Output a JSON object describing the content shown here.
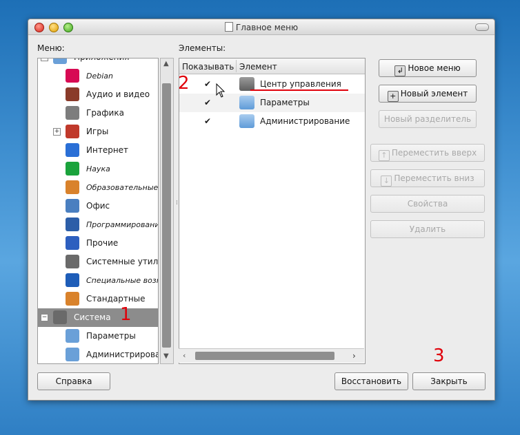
{
  "window": {
    "title": "Главное меню"
  },
  "menu_label": "Меню:",
  "elements_label": "Элементы:",
  "tree": [
    {
      "label": "Приложения",
      "italic": false,
      "icon": "folder-icon",
      "color": "#6aa0d8",
      "expander": "−"
    },
    {
      "label": "Debian",
      "italic": true,
      "icon": "debian-swirl-icon",
      "color": "#d70a53",
      "expander": ""
    },
    {
      "label": "Аудио и видео",
      "italic": false,
      "icon": "multimedia-icon",
      "color": "#8a3b2a",
      "expander": ""
    },
    {
      "label": "Графика",
      "italic": false,
      "icon": "camera-icon",
      "color": "#7d7d7d",
      "expander": ""
    },
    {
      "label": "Игры",
      "italic": false,
      "icon": "cards-icon",
      "color": "#c0392b",
      "expander": "+"
    },
    {
      "label": "Интернет",
      "italic": false,
      "icon": "globe-icon",
      "color": "#2a6fd6",
      "expander": ""
    },
    {
      "label": "Наука",
      "italic": true,
      "icon": "science-cube-icon",
      "color": "#1aa33c",
      "expander": ""
    },
    {
      "label": "Образовательные",
      "italic": true,
      "icon": "compass-icon",
      "color": "#d9822b",
      "expander": ""
    },
    {
      "label": "Офис",
      "italic": false,
      "icon": "office-icon",
      "color": "#4a7fc0",
      "expander": ""
    },
    {
      "label": "Программирование",
      "italic": true,
      "icon": "hammer-icon",
      "color": "#2c5ea8",
      "expander": ""
    },
    {
      "label": "Прочие",
      "italic": false,
      "icon": "other-apps-icon",
      "color": "#2d5fbf",
      "expander": ""
    },
    {
      "label": "Системные утилиты",
      "italic": false,
      "icon": "system-tools-icon",
      "color": "#6a6a6a",
      "expander": ""
    },
    {
      "label": "Специальные возможности",
      "italic": true,
      "icon": "accessibility-icon",
      "color": "#1e5db8",
      "expander": ""
    },
    {
      "label": "Стандартные",
      "italic": false,
      "icon": "accessories-icon",
      "color": "#d9822b",
      "expander": ""
    },
    {
      "label": "Система",
      "italic": false,
      "icon": "system-gear-icon",
      "color": "#6a6a6a",
      "expander": "−"
    },
    {
      "label": "Параметры",
      "italic": false,
      "icon": "folder-icon",
      "color": "#6aa0d8",
      "expander": ""
    },
    {
      "label": "Администрирование",
      "italic": false,
      "icon": "admin-folder-icon",
      "color": "#6aa0d8",
      "expander": ""
    }
  ],
  "table": {
    "col_show": "Показывать",
    "col_item": "Элемент",
    "rows": [
      {
        "checked": "✔",
        "label": "Центр управления",
        "icon": "control-center-icon"
      },
      {
        "checked": "✔",
        "label": "Параметры",
        "icon": "folder-icon"
      },
      {
        "checked": "✔",
        "label": "Администрирование",
        "icon": "admin-folder-icon"
      }
    ]
  },
  "buttons": {
    "new_menu": "Новое меню",
    "new_item": "Новый элемент",
    "new_separator": "Новый разделитель",
    "move_up": "Переместить вверх",
    "move_down": "Переместить вниз",
    "properties": "Свойства",
    "delete": "Удалить",
    "help": "Справка",
    "revert": "Восстановить",
    "close": "Закрыть"
  },
  "annotations": {
    "one": "1",
    "two": "2",
    "three": "3"
  }
}
